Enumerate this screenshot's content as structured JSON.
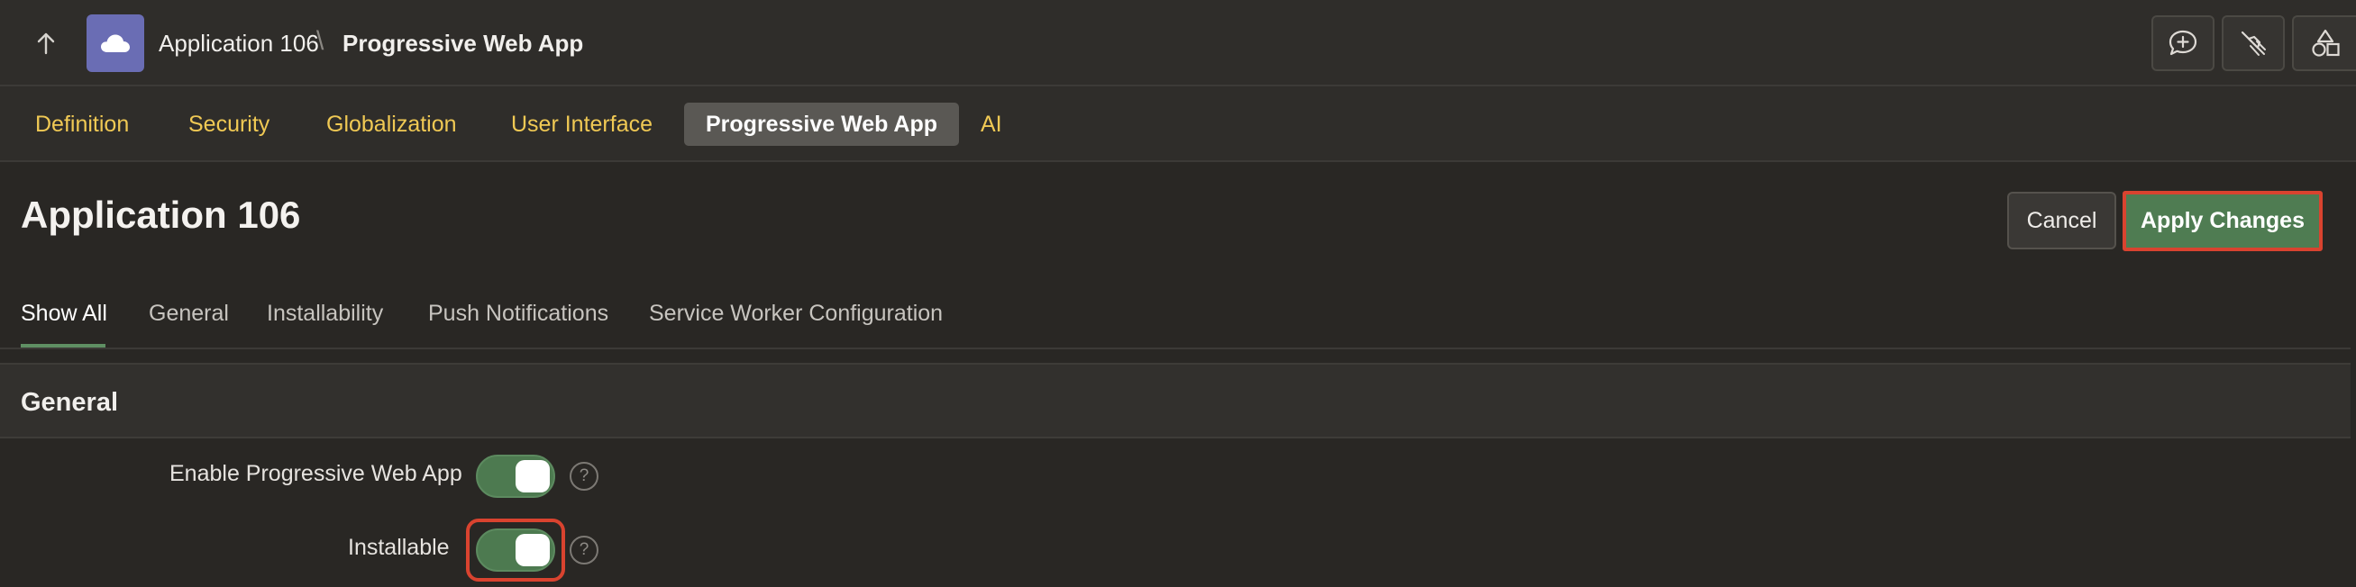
{
  "header": {
    "app_crumb": "Application 106",
    "separator": "\\",
    "page_crumb": "Progressive Web App",
    "icons": [
      "up-arrow-icon",
      "cloud-icon",
      "comment-plus-icon",
      "broom-icon",
      "shapes-icon"
    ]
  },
  "primary_tabs": [
    {
      "label": "Definition"
    },
    {
      "label": "Security"
    },
    {
      "label": "Globalization"
    },
    {
      "label": "User Interface"
    },
    {
      "label": "Progressive Web App",
      "active": true
    },
    {
      "label": "AI"
    }
  ],
  "page": {
    "title": "Application 106",
    "cancel_label": "Cancel",
    "apply_label": "Apply Changes"
  },
  "secondary_tabs": [
    {
      "label": "Show All",
      "active": true
    },
    {
      "label": "General"
    },
    {
      "label": "Installability"
    },
    {
      "label": "Push Notifications"
    },
    {
      "label": "Service Worker Configuration"
    }
  ],
  "section": {
    "title": "General",
    "fields": [
      {
        "label": "Enable Progressive Web App",
        "value": "on",
        "help": "?"
      },
      {
        "label": "Installable",
        "value": "on",
        "help": "?"
      }
    ]
  },
  "colors": {
    "background": "#292724",
    "tab_link": "#f0c954",
    "accent_green": "#4f7c52",
    "highlight_red": "#d9432f"
  }
}
